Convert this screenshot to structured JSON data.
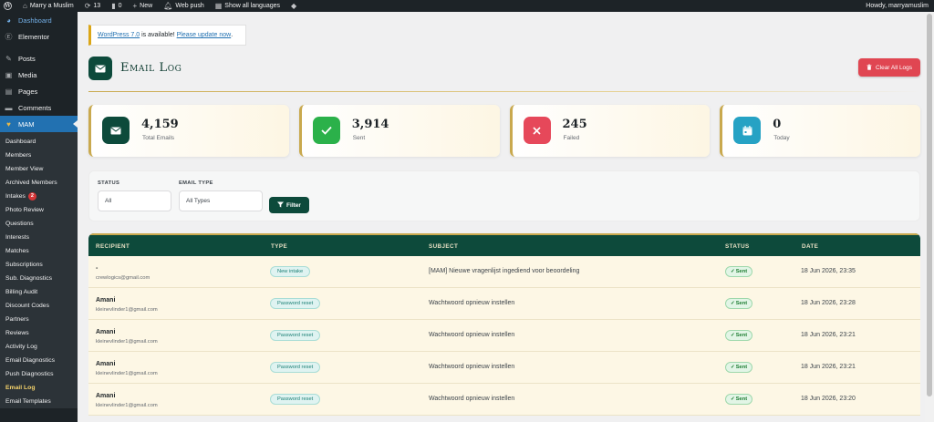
{
  "adminbar": {
    "site_name": "Marry a Muslim",
    "updates_count": "13",
    "comments_count": "0",
    "new_label": "New",
    "webpush_label": "Web push",
    "languages_label": "Show all languages",
    "howdy": "Howdy, marryamuslim"
  },
  "sidebar": {
    "top_items": [
      {
        "label": "Dashboard",
        "icon": "dashboard-icon"
      },
      {
        "label": "Elementor",
        "icon": "elementor-icon"
      }
    ],
    "main_items": [
      {
        "label": "Posts",
        "icon": "pin-icon"
      },
      {
        "label": "Media",
        "icon": "media-icon"
      },
      {
        "label": "Pages",
        "icon": "pages-icon"
      },
      {
        "label": "Comments",
        "icon": "comment-icon"
      }
    ],
    "active": {
      "label": "MAM",
      "icon": "heart-icon"
    },
    "submenu": [
      {
        "label": "Dashboard"
      },
      {
        "label": "Members"
      },
      {
        "label": "Member View"
      },
      {
        "label": "Archived Members"
      },
      {
        "label": "Intakes",
        "badge": "2"
      },
      {
        "label": "Photo Review"
      },
      {
        "label": "Questions"
      },
      {
        "label": "Interests"
      },
      {
        "label": "Matches"
      },
      {
        "label": "Subscriptions"
      },
      {
        "label": "Sub. Diagnostics"
      },
      {
        "label": "Billing Audit"
      },
      {
        "label": "Discount Codes"
      },
      {
        "label": "Partners"
      },
      {
        "label": "Reviews"
      },
      {
        "label": "Activity Log"
      },
      {
        "label": "Email Diagnostics"
      },
      {
        "label": "Push Diagnostics"
      },
      {
        "label": "Email Log",
        "current": true
      },
      {
        "label": "Email Templates"
      }
    ]
  },
  "notice": {
    "link_text": "WordPress 7.0",
    "middle_text": " is available! ",
    "update_link": "Please update now",
    "end_text": "."
  },
  "page": {
    "title": "Email Log",
    "clear_button": "Clear All Logs"
  },
  "stats": [
    {
      "value": "4,159",
      "label": "Total Emails",
      "color": "#0d4a3b",
      "icon": "envelope-icon"
    },
    {
      "value": "3,914",
      "label": "Sent",
      "color": "#2bb14a",
      "icon": "check-icon"
    },
    {
      "value": "245",
      "label": "Failed",
      "color": "#e6485a",
      "icon": "x-icon"
    },
    {
      "value": "0",
      "label": "Today",
      "color": "#26a2c4",
      "icon": "calendar-icon"
    }
  ],
  "filters": {
    "status_label": "STATUS",
    "status_value": "All",
    "type_label": "EMAIL TYPE",
    "type_value": "All Types",
    "filter_button": "Filter"
  },
  "table": {
    "headers": {
      "recipient": "RECIPIENT",
      "type": "TYPE",
      "subject": "SUBJECT",
      "status": "STATUS",
      "date": "DATE"
    },
    "rows": [
      {
        "name": "-",
        "email": "crewlogics@gmail.com",
        "type": "New intake",
        "subject": "[MAM] Nieuwe vragenlijst ingediend voor beoordeling",
        "status": "Sent",
        "date": "18 Jun 2026, 23:35"
      },
      {
        "name": "Amani",
        "email": "kleinevlinder1@gmail.com",
        "type": "Password reset",
        "subject": "Wachtwoord opnieuw instellen",
        "status": "Sent",
        "date": "18 Jun 2026, 23:28"
      },
      {
        "name": "Amani",
        "email": "kleinevlinder1@gmail.com",
        "type": "Password reset",
        "subject": "Wachtwoord opnieuw instellen",
        "status": "Sent",
        "date": "18 Jun 2026, 23:21"
      },
      {
        "name": "Amani",
        "email": "kleinevlinder1@gmail.com",
        "type": "Password reset",
        "subject": "Wachtwoord opnieuw instellen",
        "status": "Sent",
        "date": "18 Jun 2026, 23:21"
      },
      {
        "name": "Amani",
        "email": "kleinevlinder1@gmail.com",
        "type": "Password reset",
        "subject": "Wachtwoord opnieuw instellen",
        "status": "Sent",
        "date": "18 Jun 2026, 23:20"
      }
    ]
  }
}
